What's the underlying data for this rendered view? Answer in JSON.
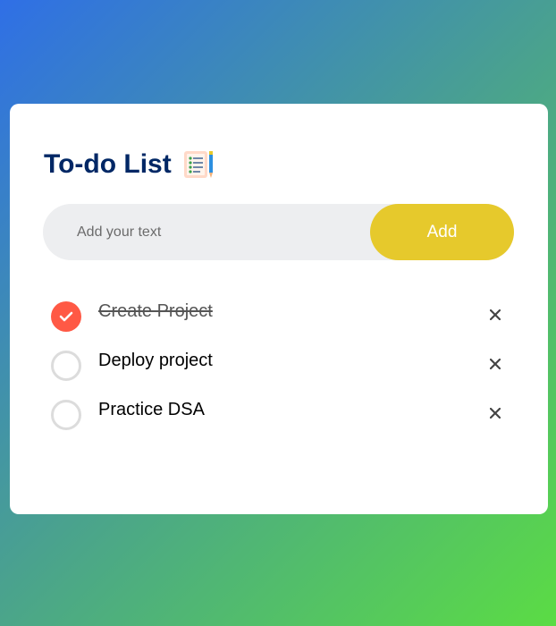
{
  "app": {
    "title": "To-do List"
  },
  "input": {
    "placeholder": "Add your text",
    "value": ""
  },
  "add_button": {
    "label": "Add"
  },
  "colors": {
    "title": "#002765",
    "add_button": "#e6c92c",
    "checked": "#ff5945",
    "gradient_start": "#2f6fe6",
    "gradient_end": "#5bdc44"
  },
  "tasks": [
    {
      "text": "Create Project",
      "done": true
    },
    {
      "text": "Deploy project",
      "done": false
    },
    {
      "text": "Practice DSA",
      "done": false
    }
  ],
  "icons": {
    "title_icon": "notepad-list-icon",
    "check": "checkmark-icon",
    "delete": "close-icon"
  }
}
